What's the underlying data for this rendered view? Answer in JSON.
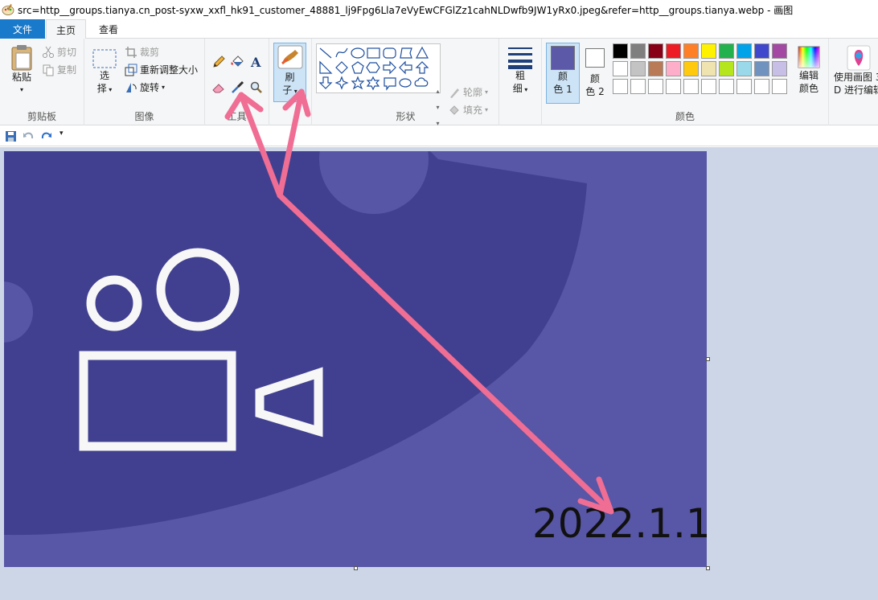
{
  "window": {
    "title": "src=http__groups.tianya.cn_post-syxw_xxfl_hk91_customer_48881_lj9Fpg6Lla7eVyEwCFGlZz1cahNLDwfb9JW1yRx0.jpeg&refer=http__groups.tianya.webp - 画图"
  },
  "tabs": {
    "file": "文件",
    "home": "主页",
    "view": "查看"
  },
  "clipboard": {
    "paste": "粘贴",
    "cut": "剪切",
    "copy": "复制",
    "group": "剪贴板"
  },
  "image_group": {
    "select_1": "选",
    "select_2": "择",
    "crop": "裁剪",
    "resize": "重新调整大小",
    "rotate": "旋转",
    "group": "图像"
  },
  "tools": {
    "group": "工具"
  },
  "brushes": {
    "label_1": "刷",
    "label_2": "子"
  },
  "shapes_group": {
    "outline": "轮廓",
    "fill": "填充",
    "group": "形状"
  },
  "size": {
    "label_1": "粗",
    "label_2": "细"
  },
  "colors": {
    "color1_1": "颜",
    "color1_2": "色 1",
    "color2_1": "颜",
    "color2_2": "色 2",
    "edit_1": "编辑",
    "edit_2": "颜色",
    "group": "颜色",
    "color1_value": "#5c5aa8",
    "row1": [
      "#000000",
      "#7f7f7f",
      "#880015",
      "#ed1c24",
      "#ff7f27",
      "#fff200",
      "#22b14c",
      "#00a2e8",
      "#3f48cc",
      "#a349a4"
    ],
    "row2": [
      "#ffffff",
      "#c3c3c3",
      "#b97a57",
      "#ffaec9",
      "#ffc90e",
      "#efe4b0",
      "#b5e61d",
      "#99d9ea",
      "#7092be",
      "#c8bfe7"
    ],
    "row3": [
      "#ffffff",
      "#ffffff",
      "#ffffff",
      "#ffffff",
      "#ffffff",
      "#ffffff",
      "#ffffff",
      "#ffffff",
      "#ffffff",
      "#ffffff"
    ]
  },
  "paint3d": {
    "label_1": "使用画图 3",
    "label_2": "D 进行编辑"
  },
  "canvas": {
    "date": "2022.1.1",
    "bg_color": "#5856a6",
    "dark_color": "#414090",
    "annotation_color": "#f06d94"
  }
}
